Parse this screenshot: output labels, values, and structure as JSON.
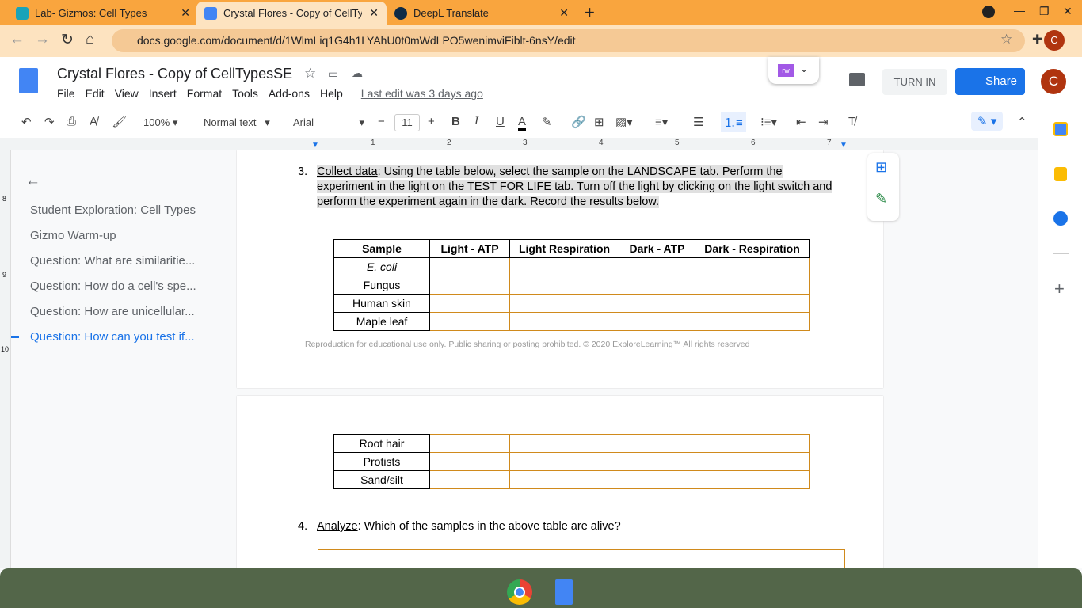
{
  "browser": {
    "tabs": [
      {
        "title": "Lab- Gizmos: Cell Types"
      },
      {
        "title": "Crystal Flores - Copy of CellTypes"
      },
      {
        "title": "DeepL Translate"
      }
    ],
    "url": "docs.google.com/document/d/1WlmLiq1G4h1LYAhU0t0mWdLPO5wenimviFiblt-6nsY/edit"
  },
  "doc": {
    "title": "Crystal Flores - Copy of CellTypesSE",
    "menus": [
      "File",
      "Edit",
      "View",
      "Insert",
      "Format",
      "Tools",
      "Add-ons",
      "Help"
    ],
    "last_edit": "Last edit was 3 days ago",
    "turn_in": "TURN IN",
    "share": "Share",
    "avatar": "C",
    "addon": "rw"
  },
  "toolbar": {
    "zoom": "100%",
    "style": "Normal text",
    "font": "Arial",
    "size": "11"
  },
  "ruler": [
    "1",
    "2",
    "3",
    "4",
    "5",
    "6",
    "7"
  ],
  "vruler": [
    "8",
    "9",
    "10"
  ],
  "outline": [
    {
      "label": "Student Exploration: Cell Types"
    },
    {
      "label": "Gizmo Warm-up"
    },
    {
      "label": "Question: What are similaritie..."
    },
    {
      "label": "Question: How do a cell's spe..."
    },
    {
      "label": "Question: How are unicellular..."
    },
    {
      "label": "Question: How can you test if...",
      "active": true
    }
  ],
  "q3": {
    "num": "3.",
    "label": "Collect data",
    "text": ": Using the table below, select the sample on the LANDSCAPE tab. Perform the experiment in the light on the TEST FOR LIFE tab. Turn off the light by clicking on the light switch and perform the experiment again in the dark. Record the results below."
  },
  "table": {
    "headers": [
      "Sample",
      "Light - ATP",
      "Light Respiration",
      "Dark - ATP",
      "Dark - Respiration"
    ],
    "rows1": [
      "E. coli",
      "Fungus",
      "Human skin",
      "Maple leaf"
    ],
    "rows2": [
      "Root hair",
      "Protists",
      "Sand/silt"
    ]
  },
  "footer": "Reproduction for educational use only. Public sharing or posting prohibited. © 2020 ExploreLearning™ All rights reserved",
  "q4": {
    "num": "4.",
    "label": "Analyze",
    "text": ": Which of the samples in the above table are alive?"
  }
}
